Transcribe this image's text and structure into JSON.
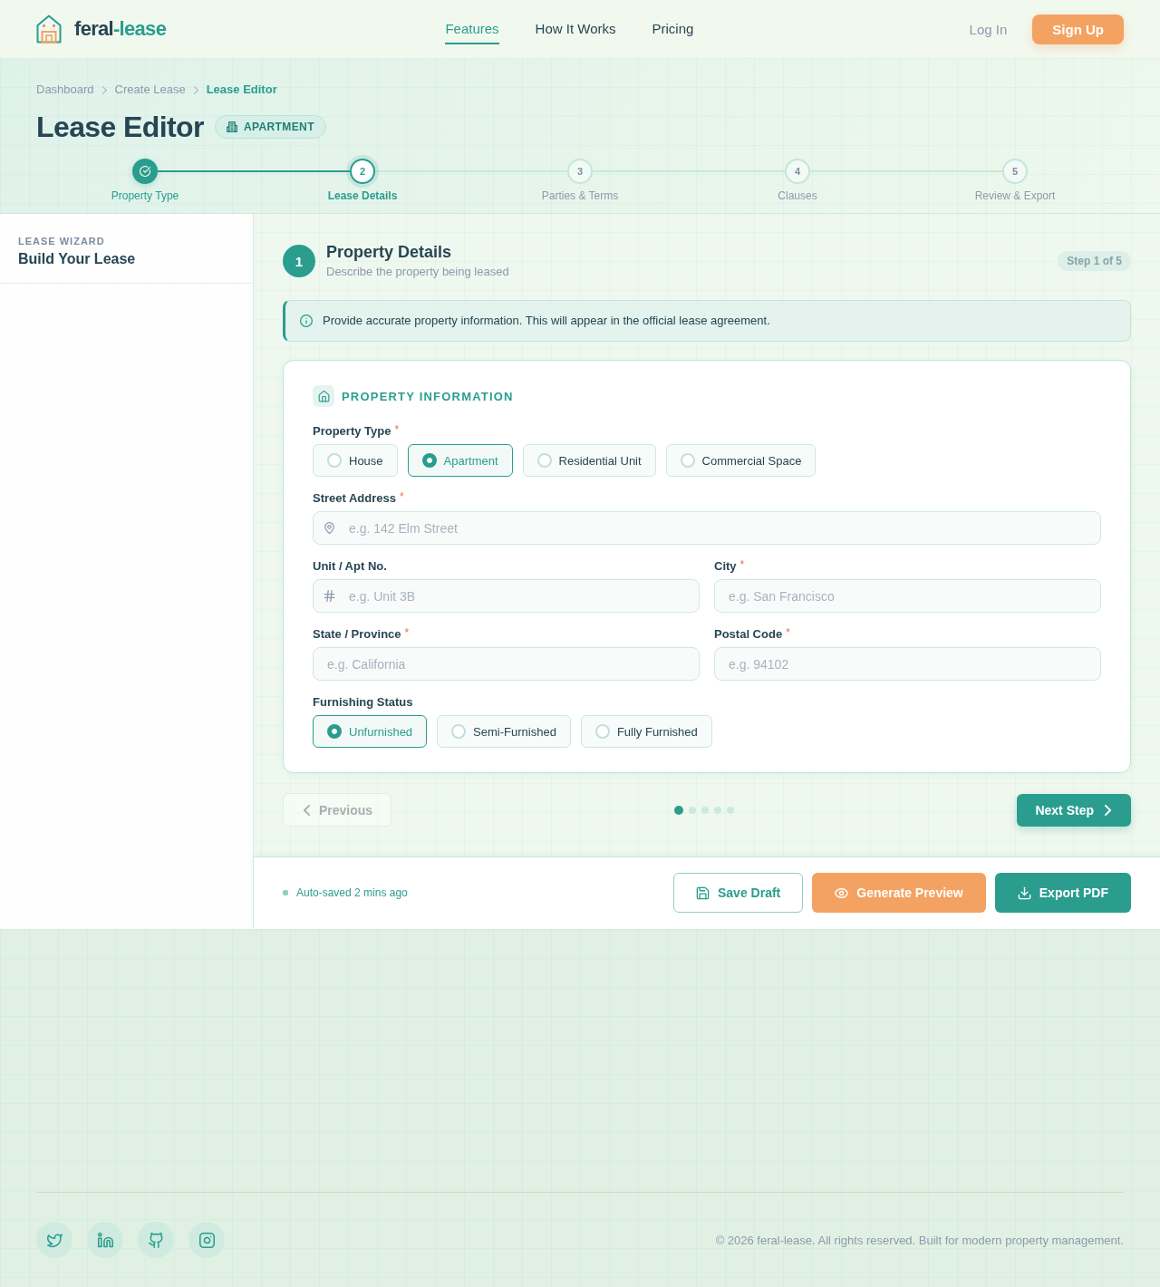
{
  "header": {
    "brand": {
      "part_1": "feral",
      "part_2": "-lease"
    },
    "nav": [
      {
        "label": "Features",
        "selected": true
      },
      {
        "label": "How It Works",
        "selected": false
      },
      {
        "label": "Pricing",
        "selected": false
      }
    ],
    "login": "Log In",
    "signup": "Sign Up"
  },
  "hero": {
    "breadcrumbs": [
      {
        "label": "Dashboard",
        "current": false
      },
      {
        "label": "Create Lease",
        "current": false
      },
      {
        "label": "Lease Editor",
        "current": true
      }
    ],
    "title": "Lease Editor",
    "badge": "APARTMENT"
  },
  "stepper": [
    {
      "label": "Property Type",
      "completed": true,
      "selected": false
    },
    {
      "number": "2",
      "label": "Lease Details",
      "completed": false,
      "selected": true
    },
    {
      "number": "3",
      "label": "Parties & Terms",
      "completed": false,
      "selected": false
    },
    {
      "number": "4",
      "label": "Clauses",
      "completed": false,
      "selected": false
    },
    {
      "number": "5",
      "label": "Review & Export",
      "completed": false,
      "selected": false
    }
  ],
  "sidebar": {
    "eyebrow": "LEASE WIZARD",
    "title": "Build Your Lease"
  },
  "section": {
    "number": "1",
    "title": "Property Details",
    "subtitle": "Describe the property being leased",
    "step_badge": "Step 1 of 5"
  },
  "notice": "Provide accurate property information. This will appear in the official lease agreement.",
  "card": {
    "title": "PROPERTY INFORMATION",
    "rows": [
      [
        {
          "kind": "choice",
          "label": "Property Type",
          "required_mark": "*",
          "options": [
            {
              "label": "House",
              "selected": false
            },
            {
              "label": "Apartment",
              "selected": true
            },
            {
              "label": "Residential Unit",
              "selected": false
            },
            {
              "label": "Commercial Space",
              "selected": false
            }
          ]
        }
      ],
      [
        {
          "kind": "location",
          "label": "Street Address",
          "required_mark": "*",
          "placeholder": "e.g. 142 Elm Street"
        }
      ],
      [
        {
          "kind": "number",
          "label": "Unit / Apt No.",
          "placeholder": "e.g. Unit 3B"
        },
        {
          "kind": "plain",
          "label": "City",
          "required_mark": "*",
          "placeholder": "e.g. San Francisco"
        }
      ],
      [
        {
          "kind": "plain",
          "label": "State / Province",
          "required_mark": "*",
          "placeholder": "e.g. California"
        },
        {
          "kind": "plain",
          "label": "Postal Code",
          "required_mark": "*",
          "placeholder": "e.g. 94102"
        }
      ],
      [
        {
          "kind": "choice",
          "label": "Furnishing Status",
          "options": [
            {
              "label": "Unfurnished",
              "selected": true
            },
            {
              "label": "Semi-Furnished",
              "selected": false
            },
            {
              "label": "Fully Furnished",
              "selected": false
            }
          ]
        }
      ]
    ]
  },
  "pager": {
    "previous": {
      "label": "Previous",
      "disabled": true
    },
    "dots": [
      {
        "selected": true
      },
      {
        "selected": false
      },
      {
        "selected": false
      },
      {
        "selected": false
      },
      {
        "selected": false
      }
    ],
    "next": "Next Step"
  },
  "action_bar": {
    "autosave": "Auto-saved 2 mins ago",
    "buttons": [
      {
        "kind": "outline",
        "label": "Save Draft"
      },
      {
        "kind": "accent",
        "label": "Generate Preview"
      },
      {
        "kind": "primary",
        "label": "Export PDF"
      }
    ]
  },
  "footer": {
    "copyright": "© 2026 feral-lease. All rights reserved. Built for modern property management."
  }
}
